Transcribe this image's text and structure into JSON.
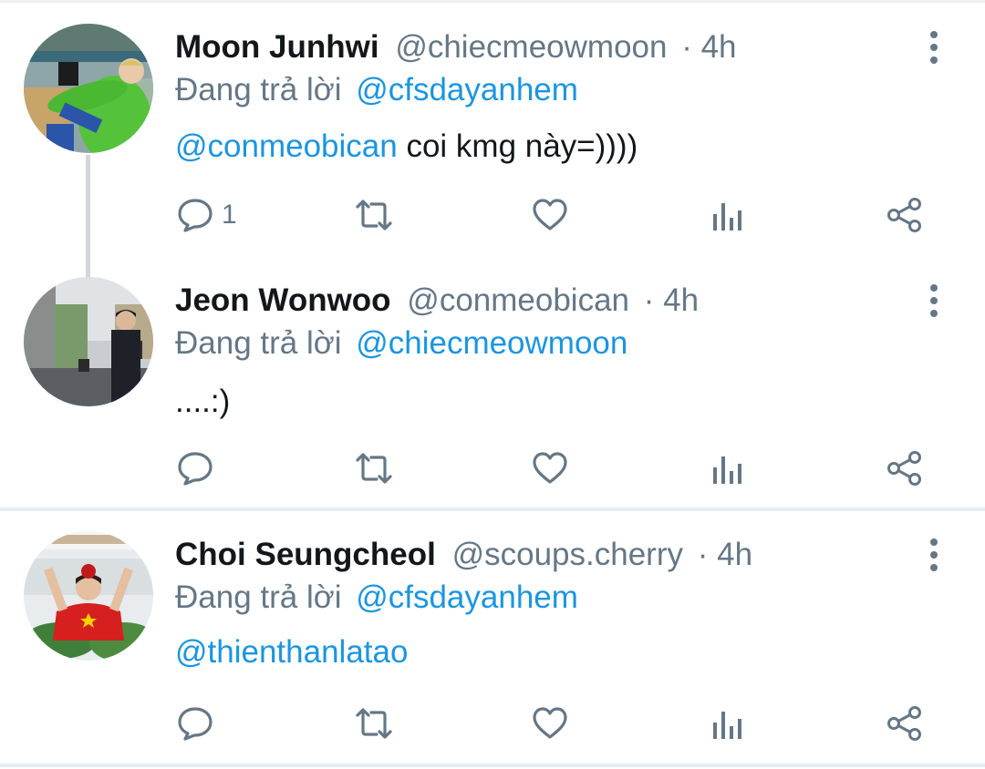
{
  "tweets": [
    {
      "name": "Moon Junhwi",
      "handle": "@chiecmeowmoon",
      "time": "· 4h",
      "replying_prefix": "Đang trả lời",
      "replying_to": "@cfsdayanhem",
      "mention": "@conmeobican",
      "text": " coi kmg này=))))",
      "reply_count": "1"
    },
    {
      "name": "Jeon Wonwoo",
      "handle": "@conmeobican",
      "time": "· 4h",
      "replying_prefix": "Đang trả lời",
      "replying_to": "@chiecmeowmoon",
      "mention": "",
      "text": "....:)",
      "reply_count": ""
    },
    {
      "name": "Choi Seungcheol",
      "handle": "@scoups.cherry",
      "time": "· 4h",
      "replying_prefix": "Đang trả lời",
      "replying_to": "@cfsdayanhem",
      "mention": "@thienthanlatao",
      "text": "",
      "reply_count": ""
    }
  ],
  "icons": {
    "reply": "reply-icon",
    "retweet": "retweet-icon",
    "like": "heart-icon",
    "analytics": "analytics-icon",
    "share": "share-icon",
    "more": "more-vertical-icon"
  },
  "colors": {
    "name": "#14171a",
    "meta": "#657786",
    "link": "#1b95e0",
    "divider": "#e6ecf0",
    "thread_line": "#d3d6d9"
  }
}
